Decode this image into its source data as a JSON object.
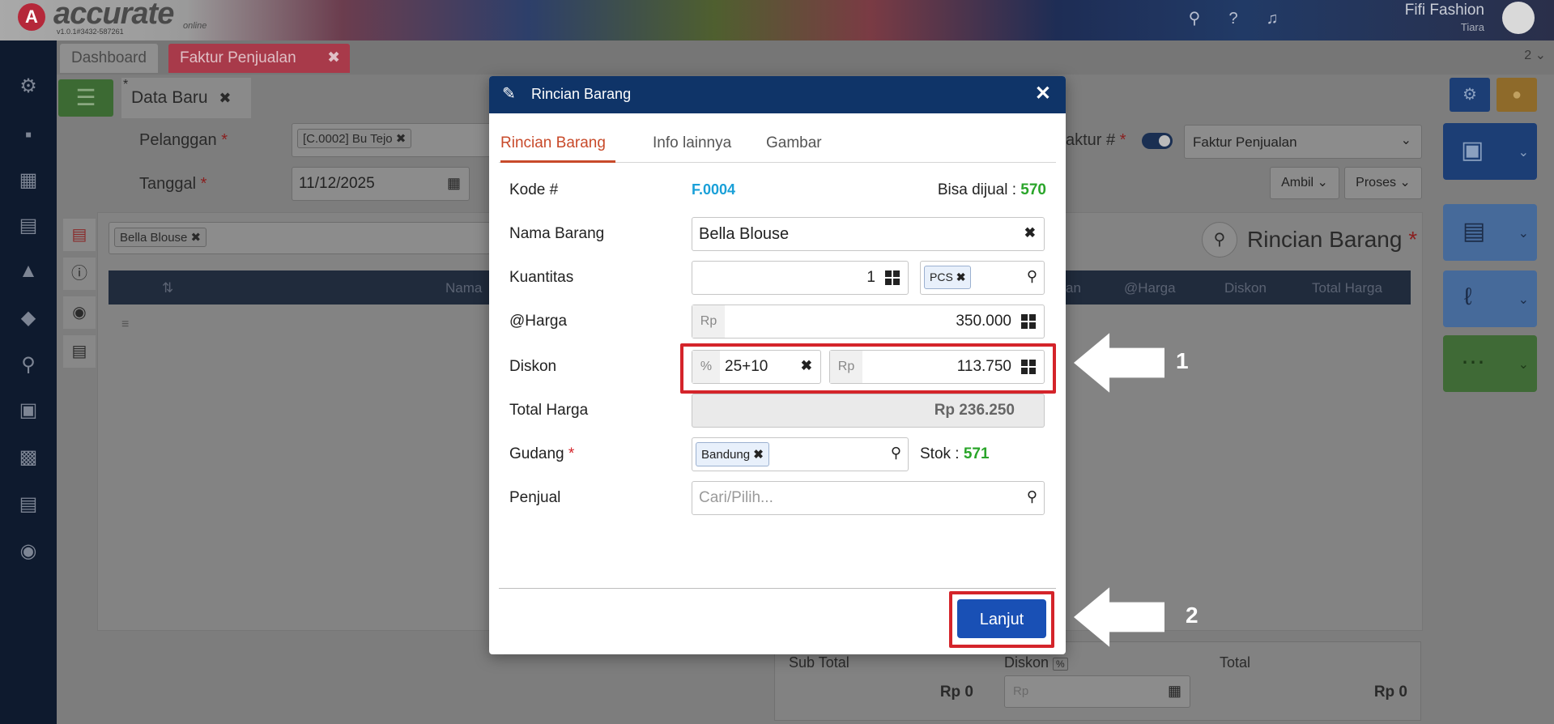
{
  "header": {
    "logo_mark": "A",
    "logo_text": "accurate",
    "logo_sub": "online",
    "version": "v1.0.1#3432-587261",
    "company": "Fifi Fashion",
    "user": "Tiara"
  },
  "tabs": {
    "dashboard": "Dashboard",
    "faktur": "Faktur Penjualan",
    "faktur_close": "✖",
    "count": "2 ⌄"
  },
  "subtab": {
    "label": "Data Baru",
    "marker": "*",
    "close": "✖"
  },
  "form": {
    "pelanggan_label": "Pelanggan",
    "pelanggan_value": "[C.0002] Bu Tejo",
    "tanggal_label": "Tanggal",
    "tanggal_value": "11/12/2025",
    "faktur_label": "aktur #",
    "faktur_type": "Faktur Penjualan",
    "ambil": "Ambil",
    "proses": "Proses",
    "required_mark": "*"
  },
  "grid": {
    "item_chip": "Bella Blouse",
    "title": "Rincian Barang",
    "columns": [
      "Nama",
      "an",
      "@Harga",
      "Diskon",
      "Total Harga"
    ]
  },
  "totals": {
    "subtotal_label": "Sub Total",
    "subtotal_value": "Rp 0",
    "diskon_label": "Diskon",
    "diskon_badge": "%",
    "diskon_prefix": "Rp",
    "total_label": "Total",
    "total_value": "Rp 0"
  },
  "modal": {
    "title": "Rincian Barang",
    "tabs": [
      "Rincian Barang",
      "Info lainnya",
      "Gambar"
    ],
    "kode_label": "Kode #",
    "kode_value": "F.0004",
    "bisa_dijual_label": "Bisa dijual :",
    "bisa_dijual_value": "570",
    "nama_label": "Nama Barang",
    "nama_value": "Bella Blouse",
    "kuantitas_label": "Kuantitas",
    "kuantitas_value": "1",
    "unit": "PCS",
    "harga_label": "@Harga",
    "harga_prefix": "Rp",
    "harga_value": "350.000",
    "diskon_label": "Diskon",
    "diskon_pct_prefix": "%",
    "diskon_pct_value": "25+10",
    "diskon_rp_prefix": "Rp",
    "diskon_rp_value": "113.750",
    "total_label": "Total Harga",
    "total_value": "Rp 236.250",
    "gudang_label": "Gudang",
    "gudang_value": "Bandung",
    "stok_label": "Stok :",
    "stok_value": "571",
    "penjual_label": "Penjual",
    "penjual_placeholder": "Cari/Pilih...",
    "lanjut": "Lanjut"
  },
  "annotations": {
    "arrow1": "1",
    "arrow2": "2"
  },
  "colors": {
    "modal_header": "#0f3468",
    "accent_tab": "#c84a2a",
    "link": "#1aa0d8",
    "green": "#2aa52a",
    "primary_button": "#1950b5",
    "highlight": "#d4242a"
  }
}
